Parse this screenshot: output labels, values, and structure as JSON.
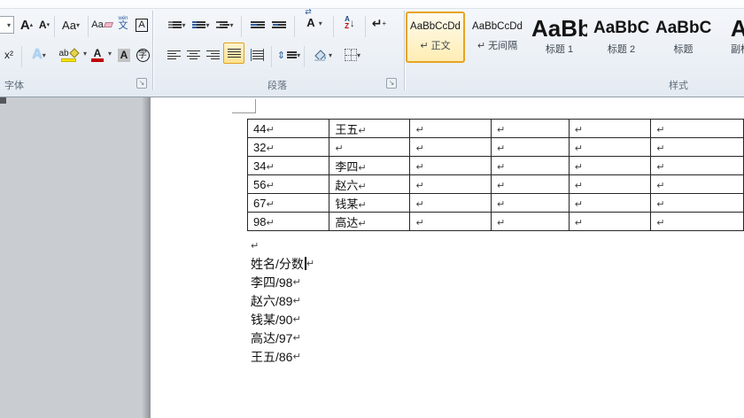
{
  "ribbon": {
    "groups": {
      "font": "字体",
      "paragraph": "段落",
      "styles": "样式"
    },
    "font_group": {
      "grow_font": "A",
      "shrink_font": "A",
      "change_case": "Aa",
      "clear_format": "Aa",
      "phonetic_top": "wén",
      "phonetic_bottom": "文",
      "char_border": "A",
      "superscript": "x²",
      "text_effects": "A",
      "highlight": "ab",
      "font_color": "A",
      "char_shading": "A",
      "enclose_char": "字"
    },
    "para_group": {
      "asian_layout": "A",
      "asian_arrows": "⇄",
      "sort_a": "A",
      "sort_z": "Z",
      "sort_arrow": "↓",
      "show_hide": "↵",
      "spacing_arrows": "⇕"
    },
    "styles": [
      {
        "sample": "AaBbCcDd",
        "name": "正文",
        "selected": true,
        "has_pilcrow": true
      },
      {
        "sample": "AaBbCcDd",
        "name": "无间隔",
        "selected": false,
        "has_pilcrow": true
      },
      {
        "sample": "AaBb",
        "name": "标题 1",
        "selected": false,
        "has_pilcrow": false
      },
      {
        "sample": "AaBbC",
        "name": "标题 2",
        "selected": false,
        "has_pilcrow": false
      },
      {
        "sample": "AaBbC",
        "name": "标题",
        "selected": false,
        "has_pilcrow": false
      },
      {
        "sample": "Aa",
        "name": "副标题",
        "selected": false,
        "has_pilcrow": false
      }
    ]
  },
  "icons": {
    "dropdown": "▾",
    "pilcrow": "↵",
    "launcher_arrow": "↘",
    "grow_caret": "▴",
    "shrink_caret": "▾",
    "plus": "+"
  },
  "doc": {
    "table": {
      "rows": [
        {
          "num": "44",
          "name": "王五"
        },
        {
          "num": "32",
          "name": ""
        },
        {
          "num": "34",
          "name": "李四"
        },
        {
          "num": "56",
          "name": "赵六"
        },
        {
          "num": "67",
          "name": "钱某"
        },
        {
          "num": "98",
          "name": "高达"
        }
      ]
    },
    "lines": [
      "姓名/分数",
      "李四/98",
      "赵六/89",
      "钱某/90",
      "高达/97",
      "王五/86"
    ]
  }
}
